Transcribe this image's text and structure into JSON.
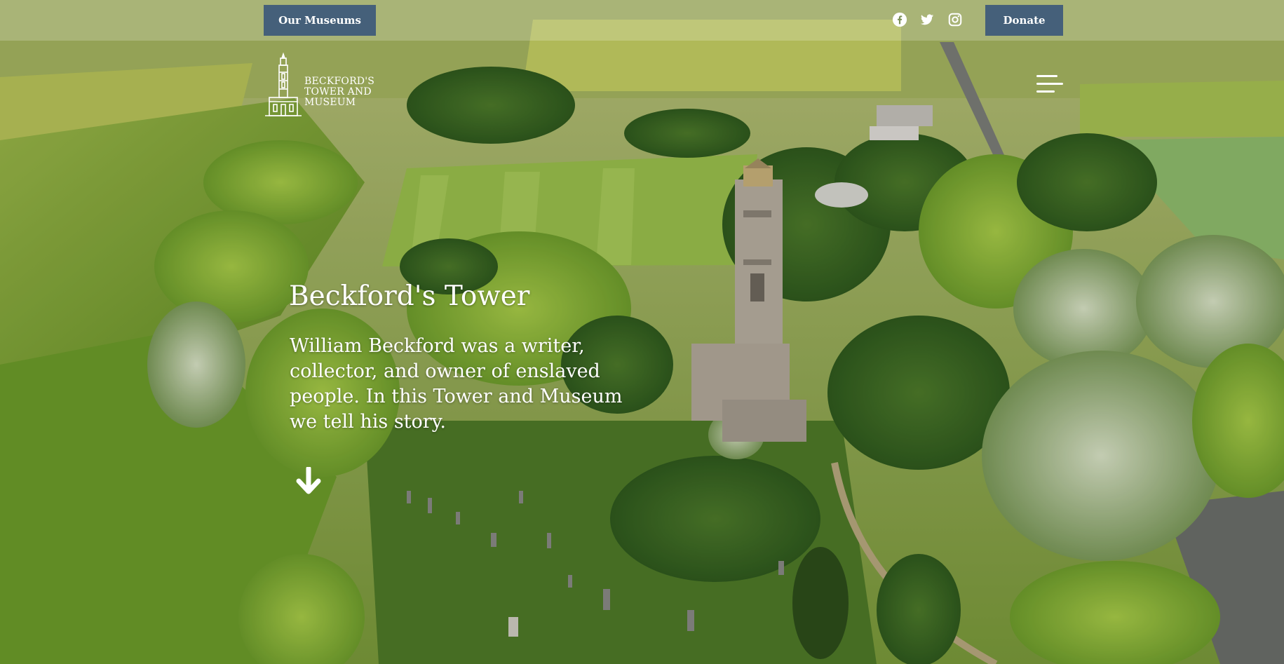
{
  "nav": {
    "museums_label": "Our Museums",
    "donate_label": "Donate",
    "social": [
      "facebook-icon",
      "twitter-icon",
      "instagram-icon"
    ]
  },
  "logo": {
    "line1": "BECKFORD'S",
    "line2": "TOWER AND",
    "line3": "MUSEUM"
  },
  "hero": {
    "title": "Beckford's Tower",
    "intro": "William Beckford was a writer, collector, and owner of enslaved people. In this Tower and Museum we tell his story."
  },
  "colors": {
    "button_bg": "#45607a",
    "text": "#ffffff",
    "topbar_overlay": "rgba(255,255,255,0.20)"
  }
}
